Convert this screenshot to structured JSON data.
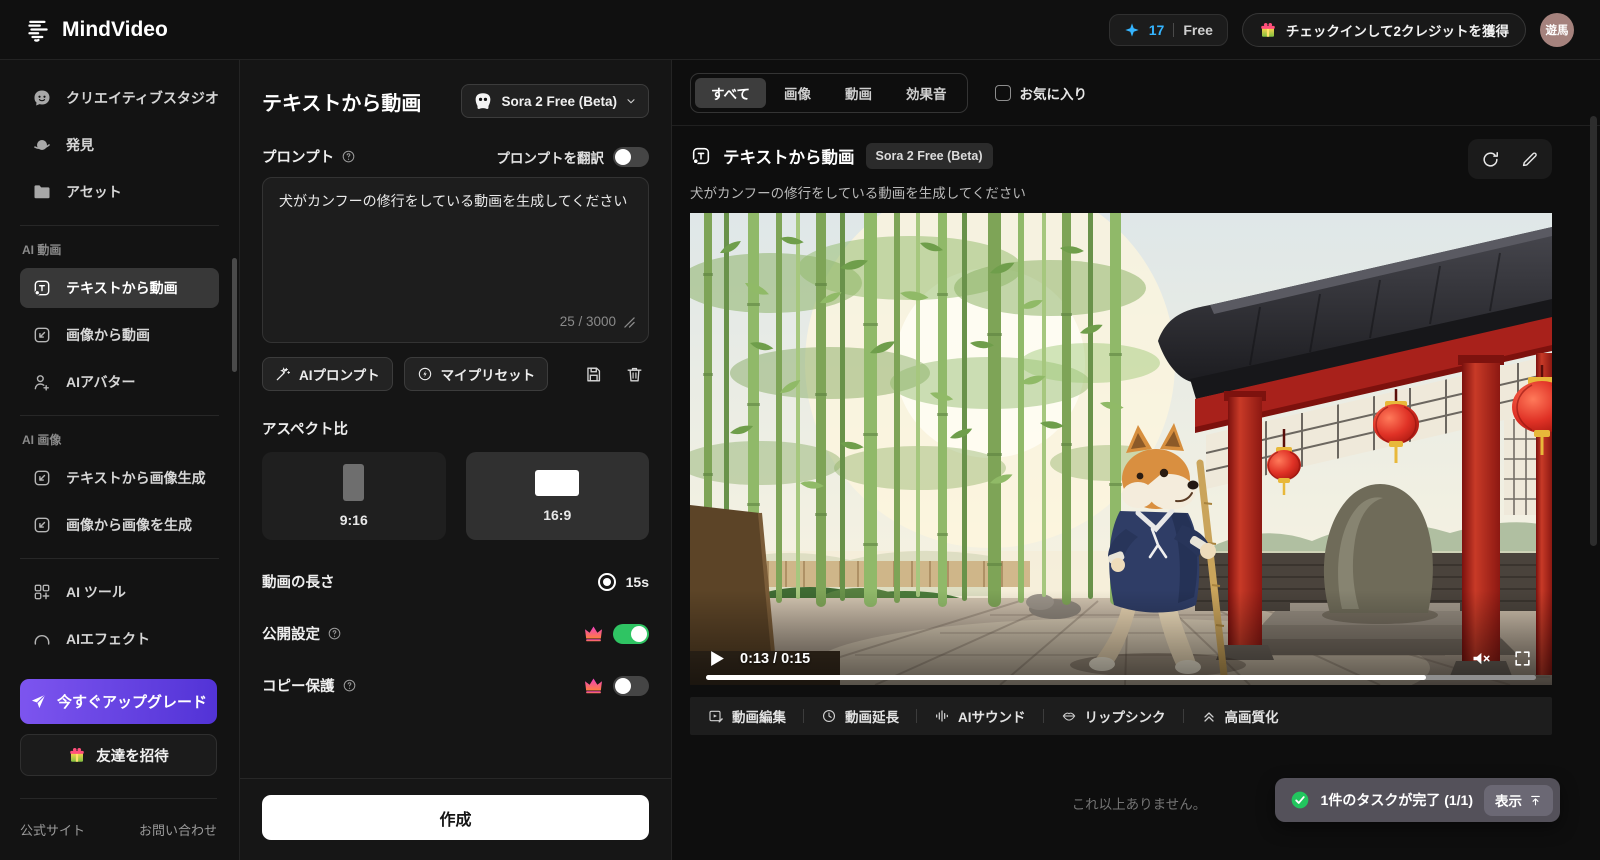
{
  "topbar": {
    "brand": "MindVideo",
    "credits": "17",
    "plan": "Free",
    "checkin_button": "チェックインして2クレジットを獲得",
    "avatar": "遊馬"
  },
  "sidebar": {
    "items_top": [
      {
        "label": "クリエイティブスタジオ"
      },
      {
        "label": "発見"
      },
      {
        "label": "アセット"
      }
    ],
    "section_video": {
      "title": "AI 動画",
      "items": [
        {
          "label": "テキストから動画"
        },
        {
          "label": "画像から動画"
        },
        {
          "label": "AIアバター"
        }
      ]
    },
    "section_image": {
      "title": "AI 画像",
      "items": [
        {
          "label": "テキストから画像生成"
        },
        {
          "label": "画像から画像を生成"
        }
      ]
    },
    "items_tools": [
      {
        "label": "AI ツール"
      },
      {
        "label": "AIエフェクト"
      }
    ],
    "upgrade_button": "今すぐアップグレード",
    "invite_button": "友達を招待",
    "footer": {
      "site": "公式サイト",
      "contact": "お問い合わせ"
    }
  },
  "composer": {
    "title": "テキストから動画",
    "model_button": "Sora 2 Free (Beta)",
    "prompt_label": "プロンプト",
    "translate_label": "プロンプトを翻訳",
    "prompt_value": "犬がカンフーの修行をしている動画を生成してください",
    "char_count": "25 / 3000",
    "ai_prompt_button": "AIプロンプト",
    "preset_button": "マイプリセット",
    "aspect_label": "アスペクト比",
    "aspect_916": "9:16",
    "aspect_169": "16:9",
    "duration_label": "動画の長さ",
    "duration_value": "15s",
    "public_label": "公開設定",
    "copy_label": "コピー保護",
    "create_button": "作成"
  },
  "gallery": {
    "tabs": [
      {
        "label": "すべて"
      },
      {
        "label": "画像"
      },
      {
        "label": "動画"
      },
      {
        "label": "効果音"
      }
    ],
    "favorites_label": "お気に入り",
    "card": {
      "type_label": "テキストから動画",
      "model_badge": "Sora 2 Free (Beta)",
      "prompt": "犬がカンフーの修行をしている動画を生成してください",
      "time_display": "0:13 / 0:15",
      "progress_percent": 86.7,
      "actions": [
        {
          "label": "動画編集"
        },
        {
          "label": "動画延長"
        },
        {
          "label": "AIサウンド"
        },
        {
          "label": "リップシンク"
        },
        {
          "label": "高画質化"
        }
      ]
    },
    "end_message": "これ以上ありません。",
    "toast": {
      "message": "1件のタスクが完了 (1/1)",
      "action": "表示"
    }
  },
  "colors": {
    "accent_purple": "#6a4be6",
    "toggle_on_green": "#2fc463",
    "credit_cyan": "#35b5ff",
    "crown_magenta": "#e93ab5",
    "create_button_white": "#ffffff",
    "toast_success_green": "#22c55e"
  }
}
